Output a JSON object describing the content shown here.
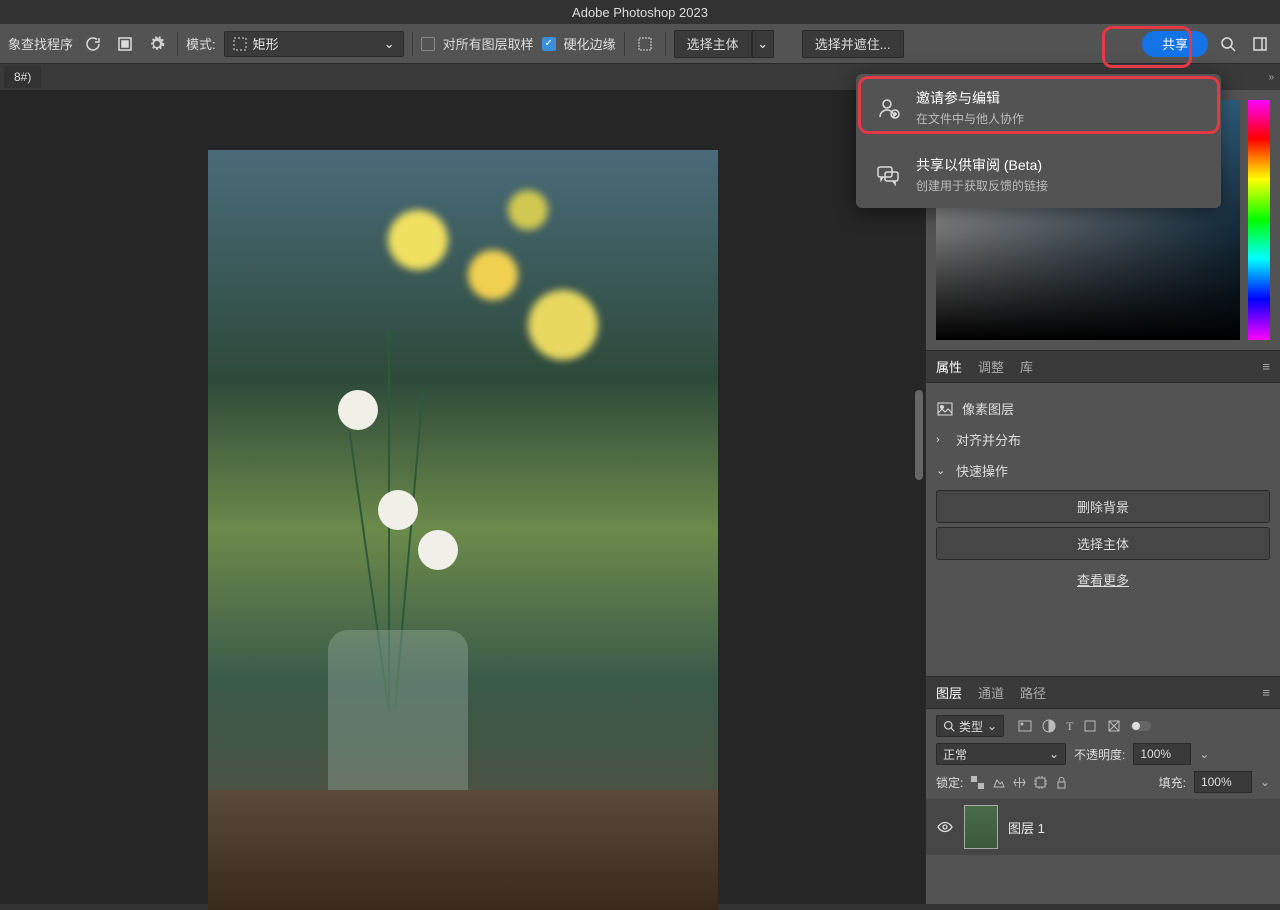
{
  "app": {
    "title": "Adobe Photoshop 2023"
  },
  "options_bar": {
    "finder_label": "象查找程序",
    "mode_label": "模式:",
    "mode_value": "矩形",
    "sample_all_label": "对所有图层取样",
    "hard_edge_label": "硬化边缘",
    "select_subject": "选择主体",
    "select_and_mask": "选择并遮住...",
    "share": "共享"
  },
  "tabs": {
    "doc1": "8#)"
  },
  "share_menu": {
    "invite_title": "邀请参与编辑",
    "invite_sub": "在文件中与他人协作",
    "review_title": "共享以供审阅 (Beta)",
    "review_sub": "创建用于获取反馈的链接"
  },
  "panels": {
    "props_tab": "属性",
    "adjust_tab": "调整",
    "lib_tab": "库",
    "pixel_layer": "像素图层",
    "align_section": "对齐并分布",
    "quick_section": "快速操作",
    "remove_bg": "删除背景",
    "select_subject_btn": "选择主体",
    "see_more": "查看更多"
  },
  "layers": {
    "tab_layers": "图层",
    "tab_channels": "通道",
    "tab_paths": "路径",
    "kind": "类型",
    "blend": "正常",
    "opacity_label": "不透明度:",
    "opacity_val": "100%",
    "lock_label": "锁定:",
    "fill_label": "填充:",
    "fill_val": "100%",
    "layer1": "图层 1"
  }
}
